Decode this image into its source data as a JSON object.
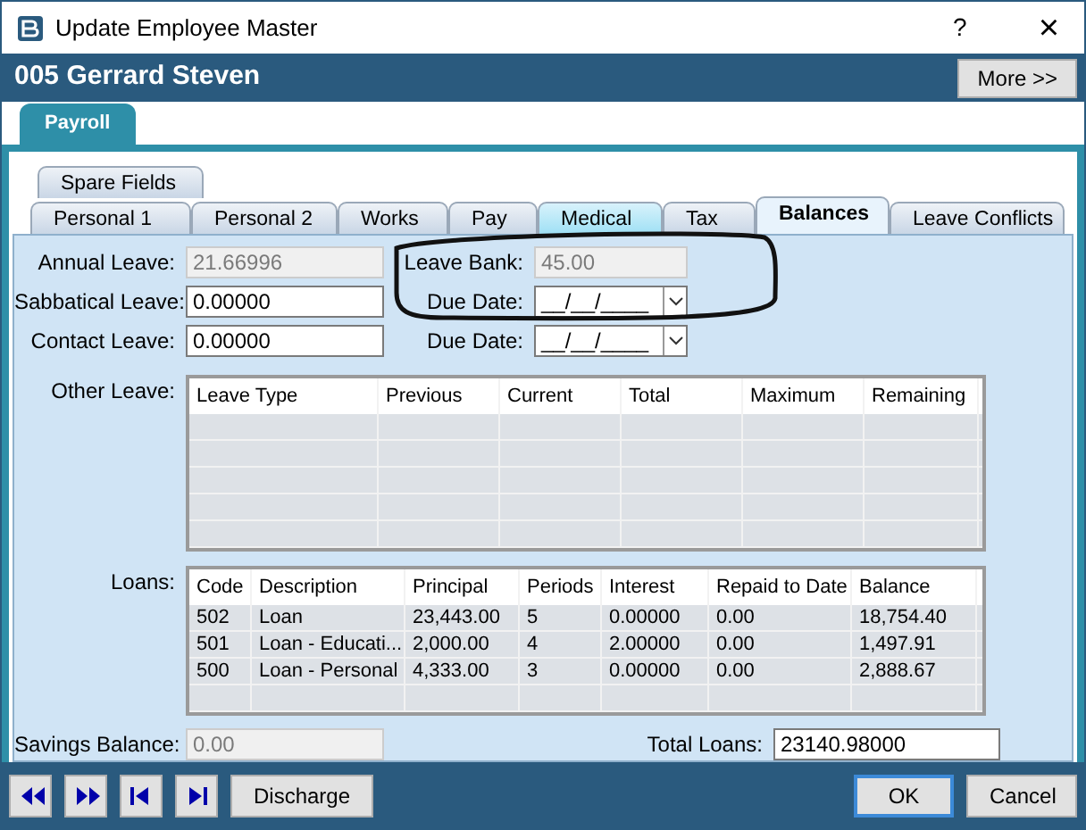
{
  "window": {
    "title": "Update Employee Master",
    "help": "?",
    "close": "×"
  },
  "header": {
    "employee": "005 Gerrard Steven",
    "more_button": "More >>"
  },
  "main_tabs": [
    {
      "label": "Payroll",
      "selected": true
    }
  ],
  "sub_tabs_top": [
    {
      "label": "Spare Fields",
      "selected": false,
      "hovered": false
    }
  ],
  "sub_tabs": [
    {
      "label": "Personal 1",
      "selected": false,
      "hovered": false
    },
    {
      "label": "Personal 2",
      "selected": false,
      "hovered": false
    },
    {
      "label": "Works",
      "selected": false,
      "hovered": false
    },
    {
      "label": "Pay",
      "selected": false,
      "hovered": false
    },
    {
      "label": "Medical",
      "selected": false,
      "hovered": true
    },
    {
      "label": "Tax",
      "selected": false,
      "hovered": false
    },
    {
      "label": "Balances",
      "selected": true,
      "hovered": false
    },
    {
      "label": "Leave Conflicts",
      "selected": false,
      "hovered": false
    }
  ],
  "fields": {
    "annual_leave": {
      "label": "Annual Leave:",
      "value": "21.66996",
      "disabled": true
    },
    "leave_bank": {
      "label": "Leave Bank:",
      "value": "45.00",
      "disabled": true
    },
    "sabbatical_leave": {
      "label": "Sabbatical Leave:",
      "value": "0.00000",
      "disabled": false
    },
    "due_date_1": {
      "label": "Due Date:",
      "value": "__/__/____"
    },
    "contact_leave": {
      "label": "Contact Leave:",
      "value": "0.00000",
      "disabled": false
    },
    "due_date_2": {
      "label": "Due Date:",
      "value": "__/__/____"
    }
  },
  "other_leave": {
    "label": "Other Leave:",
    "columns": [
      "Leave Type",
      "Previous",
      "Current",
      "Total",
      "Maximum",
      "Remaining"
    ]
  },
  "loans": {
    "label": "Loans:",
    "columns": [
      "Code",
      "Description",
      "Principal",
      "Periods",
      "Interest",
      "Repaid to Date",
      "Balance"
    ],
    "rows": [
      [
        "502",
        "Loan",
        "23,443.00",
        "5",
        "0.00000",
        "0.00",
        "18,754.40"
      ],
      [
        "501",
        "Loan - Educati...",
        "2,000.00",
        "4",
        "2.00000",
        "0.00",
        "1,497.91"
      ],
      [
        "500",
        "Loan - Personal",
        "4,333.00",
        "3",
        "0.00000",
        "0.00",
        "2,888.67"
      ]
    ]
  },
  "savings_balance": {
    "label": "Savings Balance:",
    "value": "0.00",
    "disabled": true
  },
  "total_loans": {
    "label": "Total Loans:",
    "value": "23140.98000",
    "disabled": false
  },
  "footer": {
    "nav_buttons": [
      {
        "kind": "previous"
      },
      {
        "kind": "next"
      },
      {
        "kind": "first"
      },
      {
        "kind": "last"
      }
    ],
    "discharge_button": "Discharge",
    "ok_button": "OK",
    "cancel_button": "Cancel"
  }
}
